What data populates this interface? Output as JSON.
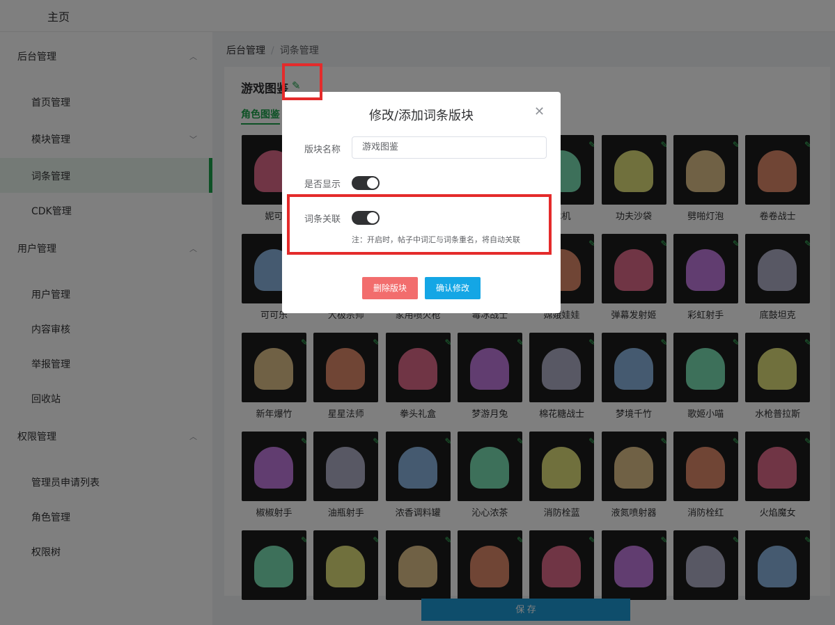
{
  "topbar": {
    "home": "主页"
  },
  "sidebar": {
    "groups": [
      {
        "label": "后台管理",
        "items": [
          "首页管理",
          "模块管理",
          "词条管理",
          "CDK管理"
        ]
      },
      {
        "label": "用户管理",
        "items": [
          "用户管理",
          "内容审核",
          "举报管理",
          "回收站"
        ]
      },
      {
        "label": "权限管理",
        "items": [
          "管理员申请列表",
          "角色管理",
          "权限树"
        ]
      }
    ],
    "active_item": "词条管理"
  },
  "breadcrumb": {
    "root": "后台管理",
    "separator": "/",
    "current": "词条管理"
  },
  "main": {
    "title": "游戏图鉴",
    "tab": "角色图鉴",
    "characters": [
      "妮可",
      "",
      "",
      "",
      "冰机",
      "功夫沙袋",
      "劈啪灯泡",
      "卷卷战士",
      "可可乐",
      "大极宗师",
      "家用喷火枪",
      "毒冰战士",
      "嫦娥娃娃",
      "弹幕发射姬",
      "彩虹射手",
      "底鼓坦克",
      "新年爆竹",
      "星星法师",
      "拳头礼盒",
      "梦游月兔",
      "棉花糖战士",
      "梦境千竹",
      "歌姬小喵",
      "水枪普拉斯",
      "椒椒射手",
      "油瓶射手",
      "浓香调料罐",
      "沁心浓茶",
      "消防栓蓝",
      "液氮喷射器",
      "消防栓红",
      "火焰魔女",
      "",
      "",
      "",
      "",
      "",
      "",
      "",
      ""
    ],
    "save_label": "保 存"
  },
  "dialog": {
    "title": "修改/添加词条版块",
    "name_label": "版块名称",
    "name_value": "游戏图鉴",
    "show_label": "是否显示",
    "show_on": true,
    "link_label": "词条关联",
    "link_on": true,
    "note": "注：开启时，帖子中词汇与词条重名，将自动关联",
    "delete_label": "删除版块",
    "confirm_label": "确认修改"
  },
  "colors": {
    "accent": "#1aa34a",
    "save": "#1c9ad6",
    "delete": "#f26d6d",
    "confirm": "#14a6e5",
    "highlight": "#e42b2b"
  }
}
